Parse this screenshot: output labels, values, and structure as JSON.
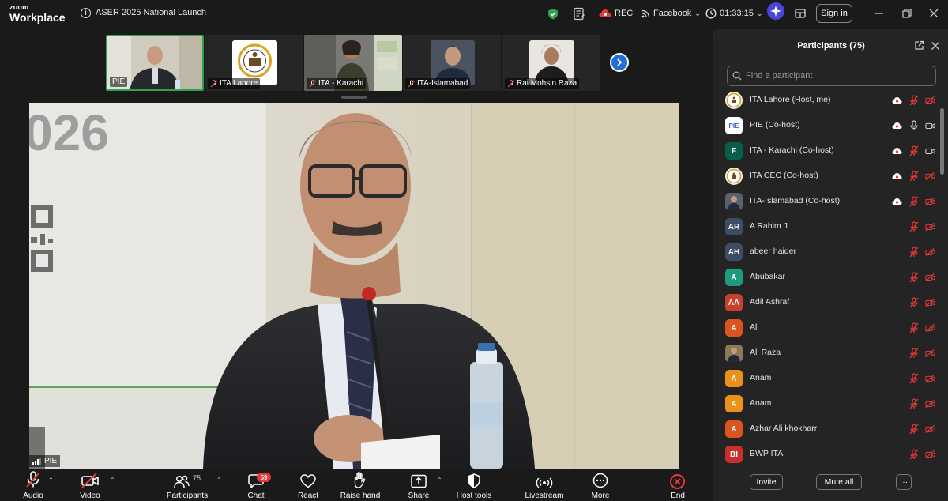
{
  "window": {
    "brand_line1": "zoom",
    "brand_line2": "Workplace",
    "meeting_title": "ASER 2025 National Launch",
    "rec_label": "REC",
    "livestream_target": "Facebook",
    "timer": "01:33:15",
    "signin_label": "Sign in"
  },
  "thumbnails": [
    {
      "name": "PIE",
      "muted": false,
      "active": true
    },
    {
      "name": "ITA Lahore",
      "muted": true,
      "active": false
    },
    {
      "name": "ITA - Karachi",
      "muted": true,
      "active": false
    },
    {
      "name": "ITA-Islamabad",
      "muted": true,
      "active": false
    },
    {
      "name": "Rai Mohsin Raza",
      "muted": true,
      "active": false
    }
  ],
  "main_video": {
    "speaker": "PIE",
    "backdrop_text": "026"
  },
  "toolbar": {
    "audio": "Audio",
    "video": "Video",
    "participants": "Participants",
    "participants_count": "75",
    "chat": "Chat",
    "chat_badge": "59",
    "react": "React",
    "raise_hand": "Raise hand",
    "share": "Share",
    "host_tools": "Host tools",
    "livestream": "Livestream",
    "more": "More",
    "end": "End"
  },
  "panel": {
    "title": "Participants (75)",
    "search_placeholder": "Find a participant",
    "invite": "Invite",
    "mute_all": "Mute all",
    "more": "···",
    "participants": [
      {
        "name": "ITA Lahore (Host, me)",
        "initials": "",
        "color": "#f2f2f2",
        "avatar": "logo",
        "cloud": true,
        "mic_muted": true,
        "cam_off": true
      },
      {
        "name": "PIE (Co-host)",
        "initials": "PIE",
        "color": "#ffffff",
        "avatar": "pie",
        "cloud": true,
        "mic_muted": false,
        "cam_off": false
      },
      {
        "name": "ITA - Karachi (Co-host)",
        "initials": "F",
        "color": "#0b5d4b",
        "avatar": "letter",
        "cloud": true,
        "mic_muted": true,
        "cam_off": false
      },
      {
        "name": "ITA CEC (Co-host)",
        "initials": "",
        "color": "#f2f2f2",
        "avatar": "logo",
        "cloud": true,
        "mic_muted": true,
        "cam_off": true
      },
      {
        "name": "ITA-Islamabad (Co-host)",
        "initials": "",
        "color": "#5a6270",
        "avatar": "photo",
        "cloud": true,
        "mic_muted": true,
        "cam_off": true
      },
      {
        "name": "A Rahim J",
        "initials": "AR",
        "color": "#3d4d63",
        "avatar": "letter",
        "cloud": false,
        "mic_muted": true,
        "cam_off": true
      },
      {
        "name": "abeer haider",
        "initials": "AH",
        "color": "#3d4d63",
        "avatar": "letter",
        "cloud": false,
        "mic_muted": true,
        "cam_off": true
      },
      {
        "name": "Abubakar",
        "initials": "A",
        "color": "#1e9a7e",
        "avatar": "letter",
        "cloud": false,
        "mic_muted": true,
        "cam_off": true
      },
      {
        "name": "Adil Ashraf",
        "initials": "AA",
        "color": "#c9402c",
        "avatar": "letter",
        "cloud": false,
        "mic_muted": true,
        "cam_off": true
      },
      {
        "name": "Ali",
        "initials": "A",
        "color": "#d9541e",
        "avatar": "letter",
        "cloud": false,
        "mic_muted": true,
        "cam_off": true
      },
      {
        "name": "Ali Raza",
        "initials": "",
        "color": "#8a7a55",
        "avatar": "photo",
        "cloud": false,
        "mic_muted": true,
        "cam_off": true
      },
      {
        "name": "Anam",
        "initials": "A",
        "color": "#e8921a",
        "avatar": "letter",
        "cloud": false,
        "mic_muted": true,
        "cam_off": true
      },
      {
        "name": "Anam",
        "initials": "A",
        "color": "#e8921a",
        "avatar": "letter",
        "cloud": false,
        "mic_muted": true,
        "cam_off": true
      },
      {
        "name": "Azhar Ali khokharr",
        "initials": "A",
        "color": "#d9541e",
        "avatar": "letter",
        "cloud": false,
        "mic_muted": true,
        "cam_off": true
      },
      {
        "name": "BWP ITA",
        "initials": "BI",
        "color": "#c9302c",
        "avatar": "letter",
        "cloud": false,
        "mic_muted": true,
        "cam_off": true
      }
    ]
  },
  "colors": {
    "accent_green": "#2ea44f",
    "accent_blue": "#1f6fd6",
    "danger_red": "#e53935"
  }
}
